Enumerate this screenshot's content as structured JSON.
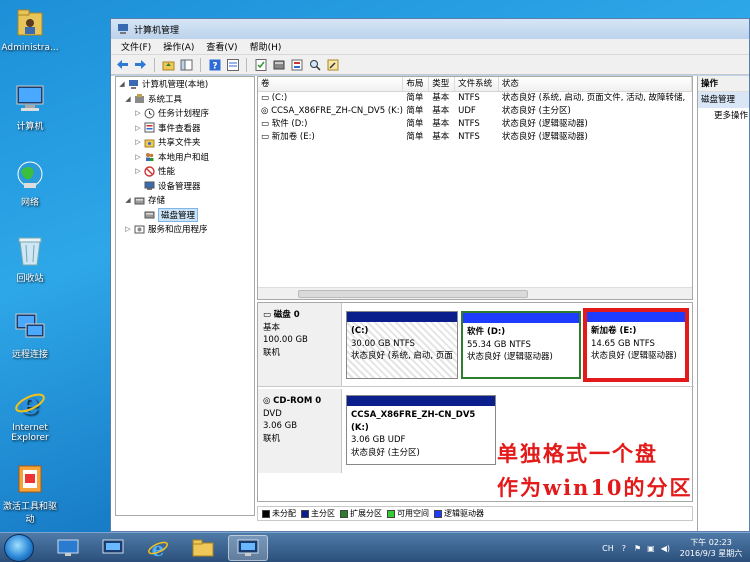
{
  "desktop": {
    "icons": [
      {
        "label": "Administra..."
      },
      {
        "label": "计算机"
      },
      {
        "label": "网络"
      },
      {
        "label": "回收站"
      },
      {
        "label": "远程连接"
      },
      {
        "label": "Internet Explorer"
      },
      {
        "label": "激活工具和驱动"
      }
    ]
  },
  "window": {
    "title": "计算机管理",
    "menu": [
      "文件(F)",
      "操作(A)",
      "查看(V)",
      "帮助(H)"
    ]
  },
  "tree": {
    "root": "计算机管理(本地)",
    "system_tools": "系统工具",
    "task_scheduler": "任务计划程序",
    "event_viewer": "事件查看器",
    "shared_folders": "共享文件夹",
    "local_users": "本地用户和组",
    "performance": "性能",
    "device_manager": "设备管理器",
    "storage": "存储",
    "disk_management": "磁盘管理",
    "services_apps": "服务和应用程序"
  },
  "volumes": {
    "headers": [
      "卷",
      "布局",
      "类型",
      "文件系统",
      "状态"
    ],
    "rows": [
      {
        "name": "(C:)",
        "layout": "简单",
        "type": "基本",
        "fs": "NTFS",
        "status": "状态良好 (系统, 启动, 页面文件, 活动, 故障转储,"
      },
      {
        "name": "CCSA_X86FRE_ZH-CN_DV5 (K:)",
        "layout": "简单",
        "type": "基本",
        "fs": "UDF",
        "status": "状态良好 (主分区)"
      },
      {
        "name": "软件 (D:)",
        "layout": "简单",
        "type": "基本",
        "fs": "NTFS",
        "status": "状态良好 (逻辑驱动器)"
      },
      {
        "name": "新加卷 (E:)",
        "layout": "简单",
        "type": "基本",
        "fs": "NTFS",
        "status": "状态良好 (逻辑驱动器)"
      }
    ]
  },
  "disk0": {
    "name": "磁盘 0",
    "type": "基本",
    "size": "100.00 GB",
    "state": "联机",
    "partitions": [
      {
        "name": "(C:)",
        "size": "30.00 GB NTFS",
        "status": "状态良好 (系统, 启动, 页面"
      },
      {
        "name": "软件 (D:)",
        "size": "55.34 GB NTFS",
        "status": "状态良好 (逻辑驱动器)"
      },
      {
        "name": "新加卷 (E:)",
        "size": "14.65 GB NTFS",
        "status": "状态良好 (逻辑驱动器)"
      }
    ]
  },
  "cdrom0": {
    "name": "CD-ROM 0",
    "type": "DVD",
    "size": "3.06 GB",
    "state": "联机",
    "partition": {
      "name": "CCSA_X86FRE_ZH-CN_DV5 (K:)",
      "size": "3.06 GB UDF",
      "status": "状态良好 (主分区)"
    }
  },
  "legend": [
    {
      "label": "未分配",
      "color": "#000000"
    },
    {
      "label": "主分区",
      "color": "#0a1e8c"
    },
    {
      "label": "扩展分区",
      "color": "#2d7d2d"
    },
    {
      "label": "可用空间",
      "color": "#33cc33"
    },
    {
      "label": "逻辑驱动器",
      "color": "#1e3cff"
    }
  ],
  "actions": {
    "header": "操作",
    "section": "磁盘管理",
    "more": "更多操作"
  },
  "annotation": {
    "line1": "单独格式一个盘",
    "line2": "作为win10的分区"
  },
  "taskbar": {
    "lang": "CH",
    "time": "下午 02:23",
    "date": "2016/9/3 星期六"
  },
  "colors": {
    "primary": "#0a1e8c",
    "logical": "#1e3cff",
    "highlight": "#e31a1a"
  }
}
